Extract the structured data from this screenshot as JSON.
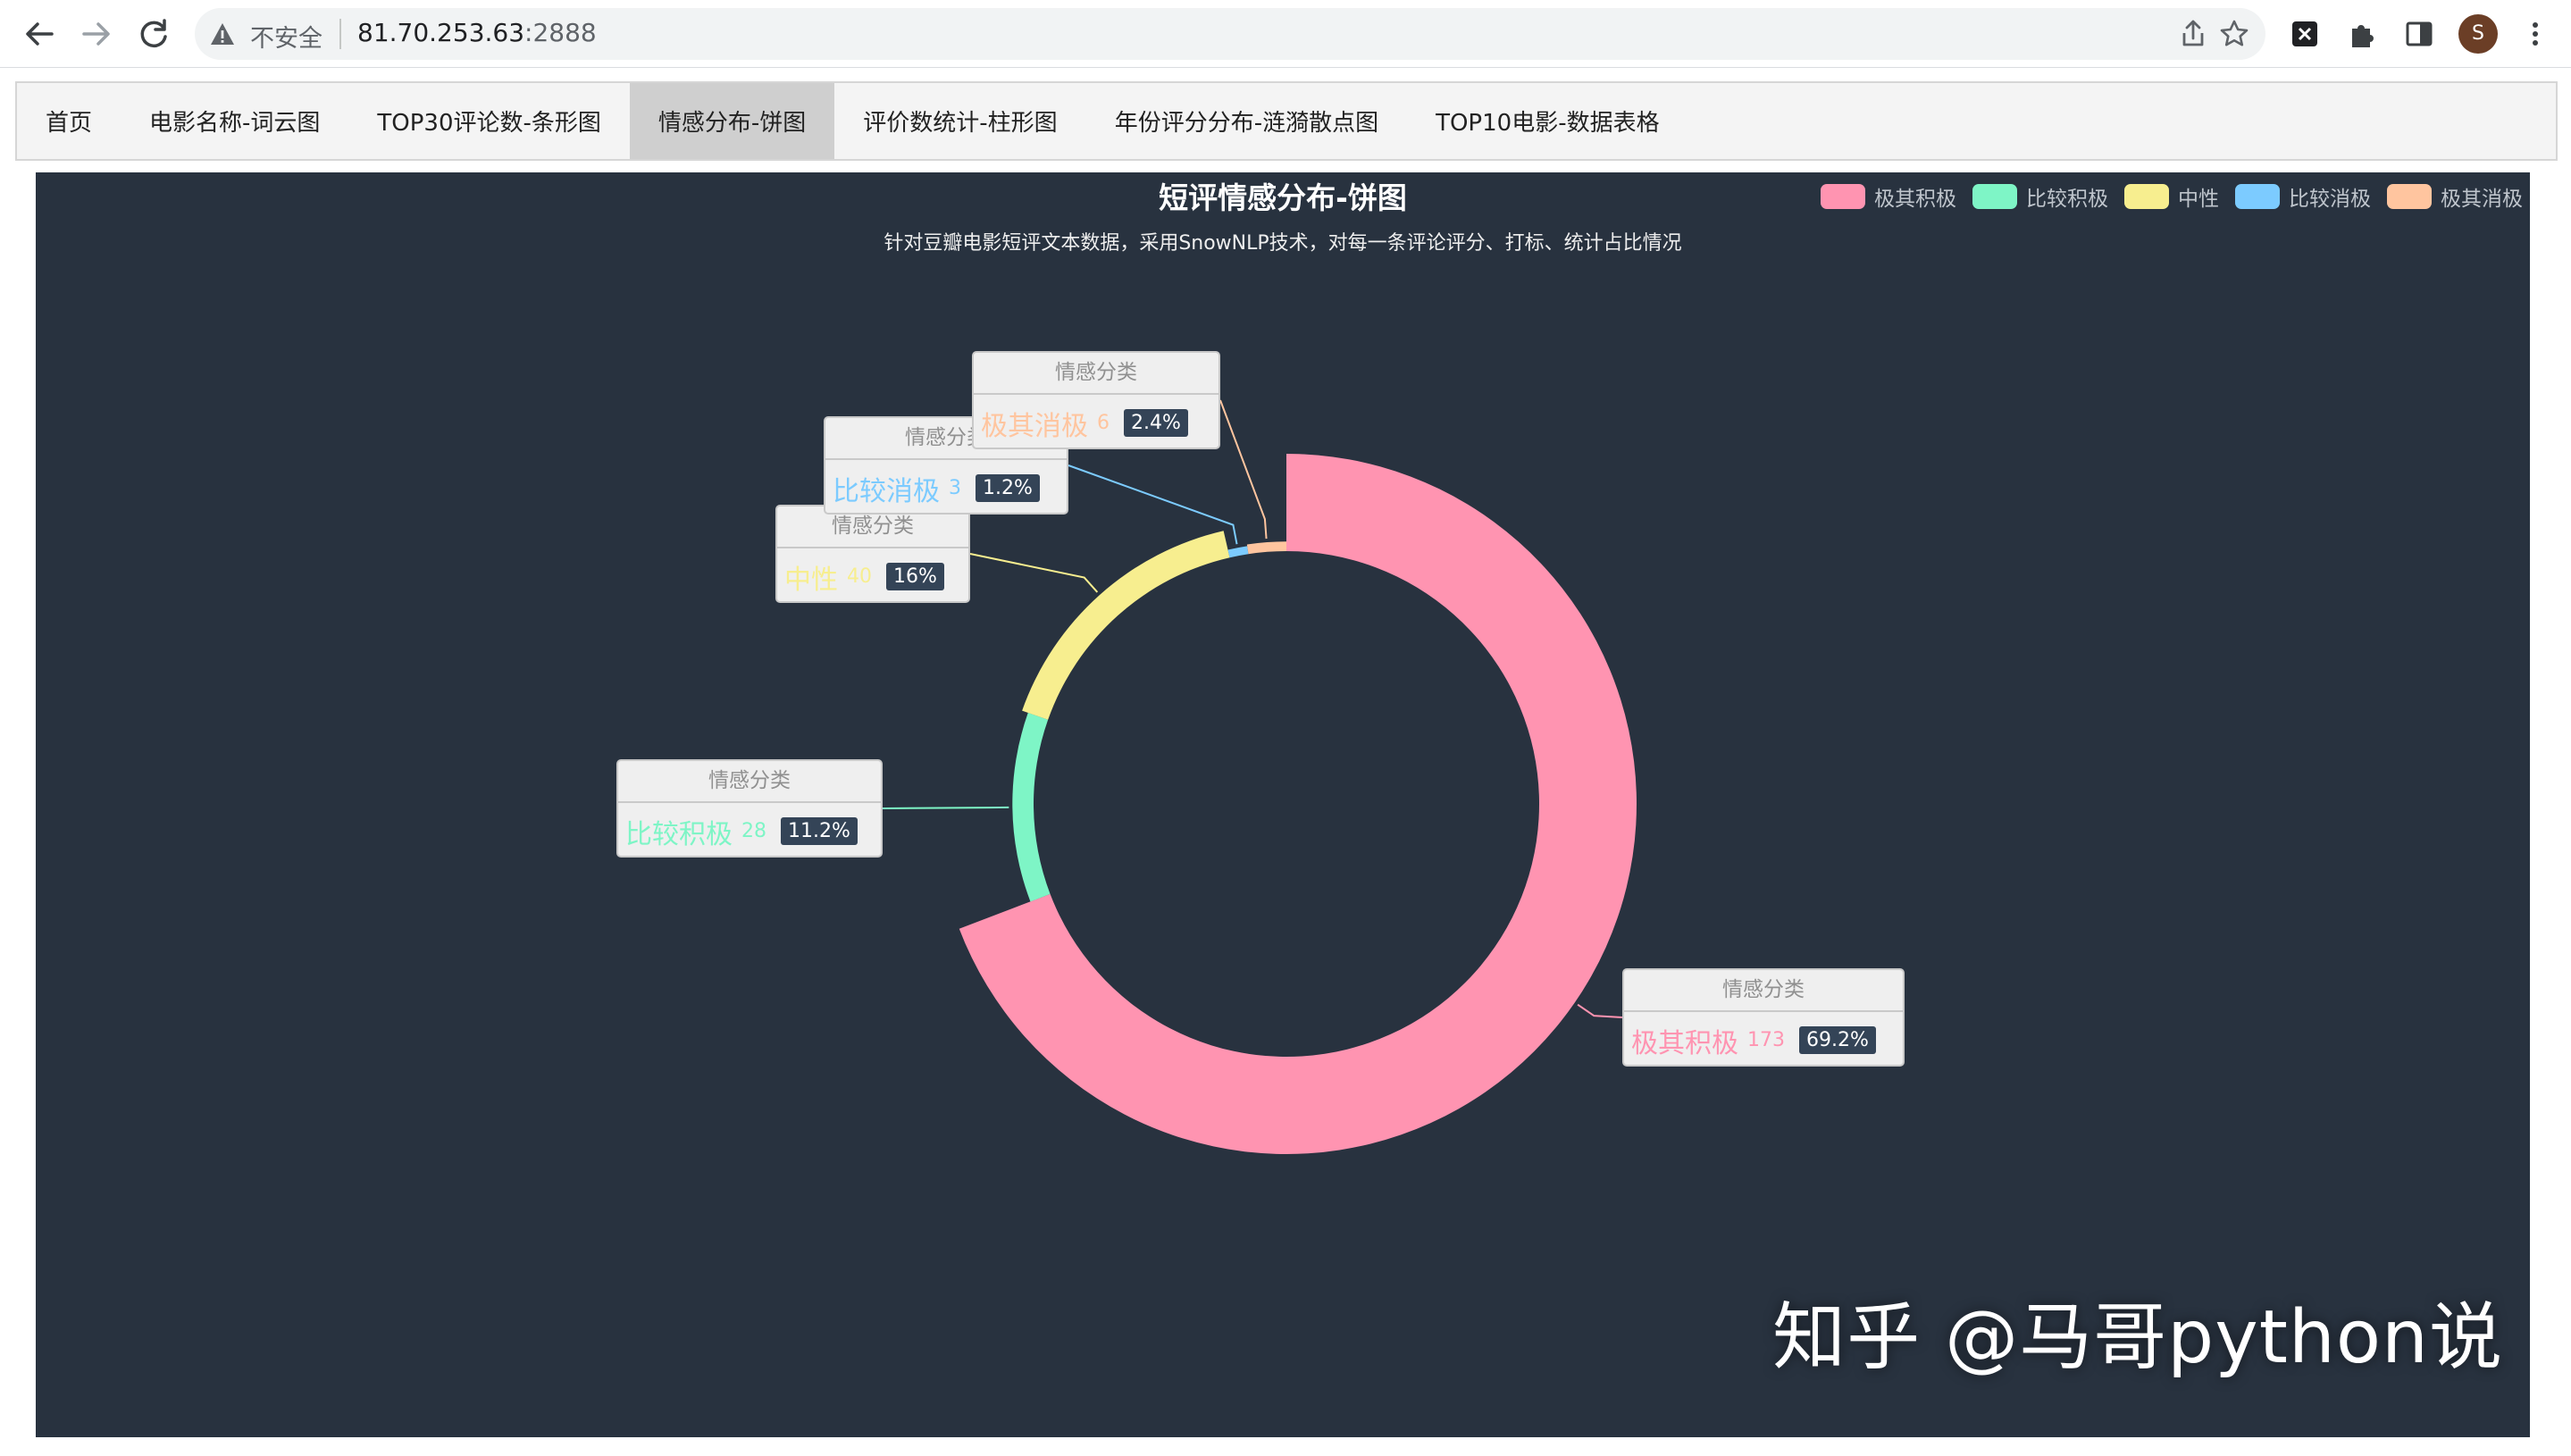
{
  "browser": {
    "security_label": "不安全",
    "url_host": "81.70.253.63",
    "url_port": ":2888",
    "avatar_letter": "S"
  },
  "nav": {
    "items": [
      {
        "label": "首页"
      },
      {
        "label": "电影名称-词云图"
      },
      {
        "label": "TOP30评论数-条形图"
      },
      {
        "label": "情感分布-饼图",
        "active": true
      },
      {
        "label": "评价数统计-柱形图"
      },
      {
        "label": "年份评分分布-涟漪散点图"
      },
      {
        "label": "TOP10电影-数据表格"
      }
    ]
  },
  "chart": {
    "background": "#28323f",
    "tooltip_header": "情感分类"
  },
  "chart_data": {
    "type": "pie",
    "variant": "donut",
    "title": "短评情感分布-饼图",
    "subtitle": "针对豆瓣电影短评文本数据，采用SnowNLP技术，对每一条评论评分、打标、统计占比情况",
    "legend_position": "top-right",
    "series_label": "情感分类",
    "categories": [
      "极其积极",
      "比较积极",
      "中性",
      "比较消极",
      "极其消极"
    ],
    "values": [
      173,
      28,
      40,
      3,
      6
    ],
    "percents": [
      "69.2%",
      "11.2%",
      "16%",
      "1.2%",
      "2.4%"
    ],
    "colors": [
      "#ff94b1",
      "#7ef5c6",
      "#f7ee8f",
      "#7ccbff",
      "#ffc59f"
    ]
  },
  "watermark": "知乎 @马哥python说"
}
